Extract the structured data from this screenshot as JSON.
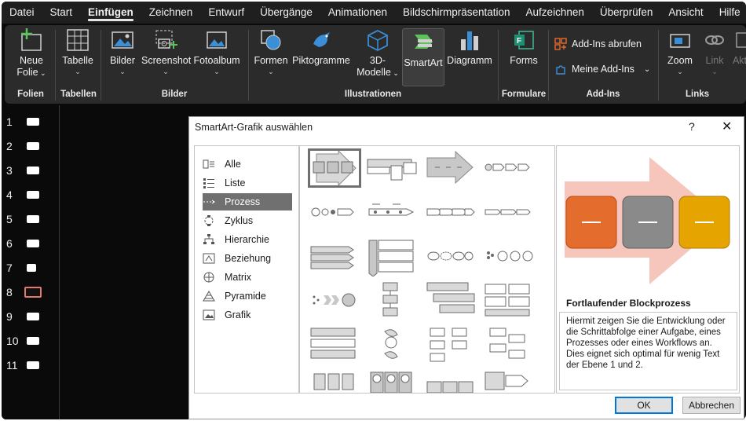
{
  "menu": [
    "Datei",
    "Start",
    "Einfügen",
    "Zeichnen",
    "Entwurf",
    "Übergänge",
    "Animationen",
    "Bildschirmpräsentation",
    "Aufzeichnen",
    "Überprüfen",
    "Ansicht",
    "Hilfe"
  ],
  "ribbon": {
    "neue_folie": [
      "Neue",
      "Folie"
    ],
    "tabelle": "Tabelle",
    "bilder": "Bilder",
    "screenshot": "Screenshot",
    "fotoalbum": "Fotoalbum",
    "formen": "Formen",
    "piktogramme": "Piktogramme",
    "modelle": [
      "3D-",
      "Modelle"
    ],
    "smartart": "SmartArt",
    "diagramm": "Diagramm",
    "forms": "Forms",
    "addins_abrufen": "Add-Ins abrufen",
    "meine_addins": "Meine Add-Ins",
    "zoom": "Zoom",
    "link": "Link",
    "aktion": "Akt",
    "groups": [
      "Folien",
      "Tabellen",
      "Bilder",
      "Illustrationen",
      "Formulare",
      "Add-Ins",
      "Links"
    ]
  },
  "slides": [
    "1",
    "2",
    "3",
    "4",
    "5",
    "6",
    "7",
    "8",
    "9",
    "10",
    "11"
  ],
  "dialog": {
    "title": "SmartArt-Grafik auswählen",
    "help": "?",
    "close": "✕",
    "categories": [
      "Alle",
      "Liste",
      "Prozess",
      "Zyklus",
      "Hierarchie",
      "Beziehung",
      "Matrix",
      "Pyramide",
      "Grafik"
    ],
    "selected_category": "Prozess",
    "preview_title": "Fortlaufender Blockprozess",
    "preview_desc": "Hiermit zeigen Sie die Entwicklung oder die Schrittabfolge einer Aufgabe, eines Prozesses oder eines Workflows an. Dies eignet sich optimal für wenig Text der Ebene 1 und 2.",
    "ok": "OK",
    "cancel": "Abbrechen"
  },
  "colors": {
    "accent_orange": "#e46c2c",
    "accent_gray": "#8a8a8a",
    "accent_gold": "#e6a400",
    "arrow_pink": "#f6c6bc",
    "selection_outline": "#e07a6c"
  }
}
